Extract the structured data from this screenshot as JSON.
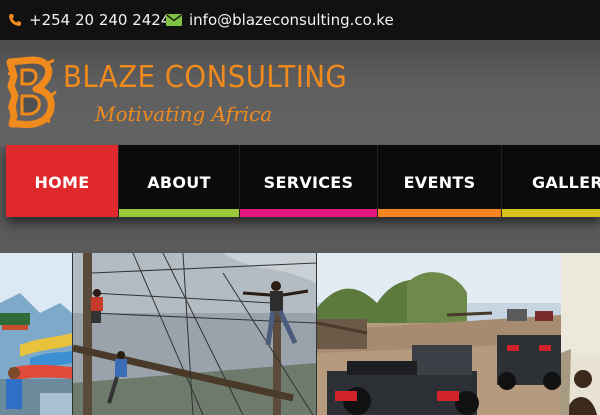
{
  "contact": {
    "phone": "+254 20 240 2424",
    "email": "info@blazeconsulting.co.ke",
    "phone_icon": "phone-icon",
    "email_icon": "envelope-icon",
    "icon_colors": {
      "phone": "#f08a1c",
      "email": "#7fc241"
    }
  },
  "brand": {
    "name": "BLAZE CONSULTING",
    "tagline": "Motivating Africa",
    "logo_letter": "B",
    "color": "#f08a1c"
  },
  "nav": {
    "items": [
      {
        "label": "HOME",
        "active": true,
        "color": "#e0292d"
      },
      {
        "label": "ABOUT",
        "color": "#9bc93a"
      },
      {
        "label": "SERVICES",
        "color": "#e4197f"
      },
      {
        "label": "EVENTS",
        "color": "#f6851f"
      },
      {
        "label": "GALLERY",
        "color": "#d8c21a"
      }
    ]
  },
  "gallery": {
    "photos": [
      {
        "subject": "water-park-photo"
      },
      {
        "subject": "ropes-course-photo"
      },
      {
        "subject": "quad-bikes-photo"
      },
      {
        "subject": "person-photo"
      }
    ]
  }
}
